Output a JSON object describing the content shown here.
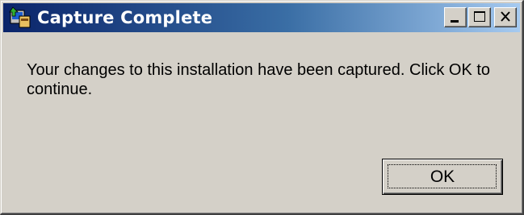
{
  "window": {
    "title": "Capture Complete",
    "icon": "installer-app-icon"
  },
  "title_buttons": {
    "minimize": "minimize-icon",
    "maximize": "maximize-icon",
    "close": "close-icon"
  },
  "message": {
    "text": "Your changes to this installation have been captured. Click OK to continue."
  },
  "buttons": {
    "ok_label": "OK"
  },
  "colors": {
    "titlebar_start": "#0a246a",
    "titlebar_end": "#a6caf0",
    "face": "#d4d0c8"
  }
}
